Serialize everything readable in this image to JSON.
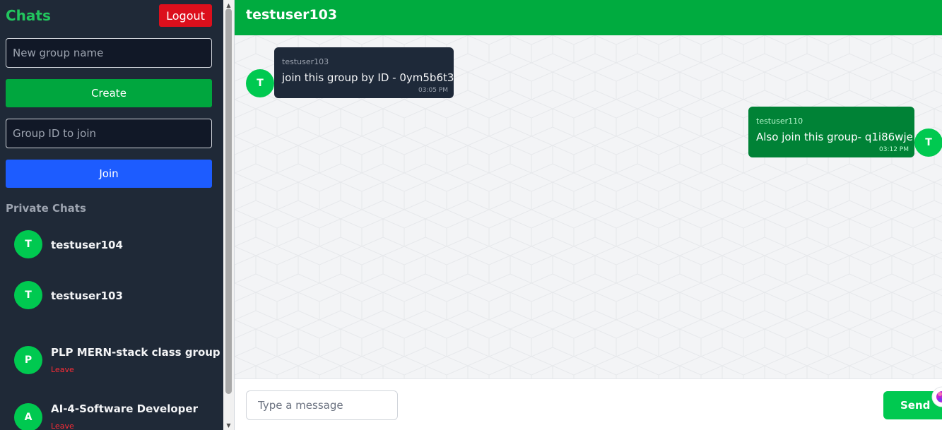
{
  "sidebar": {
    "title": "Chats",
    "logout_label": "Logout",
    "group_name_placeholder": "New group name",
    "create_label": "Create",
    "group_id_placeholder": "Group ID to join",
    "join_label": "Join",
    "section_title": "Private Chats",
    "chats": [
      {
        "initial": "T",
        "name": "testuser104",
        "leave": ""
      },
      {
        "initial": "T",
        "name": "testuser103",
        "leave": ""
      },
      {
        "initial": "P",
        "name": "PLP MERN-stack class group",
        "leave": "Leave"
      },
      {
        "initial": "A",
        "name": "AI-4-Software Developer",
        "leave": "Leave"
      }
    ]
  },
  "main": {
    "header_title": "testuser103",
    "messages": [
      {
        "initial": "T",
        "sender": "testuser103",
        "text": "join this group by ID - 0ym5b6t3",
        "time": "03:05 PM"
      },
      {
        "initial": "T",
        "sender": "testuser110",
        "text": "Also join this group- q1i86wje",
        "time": "03:12 PM"
      }
    ],
    "input_placeholder": "Type a message",
    "send_label": "Send"
  },
  "scrollbar": {
    "up_icon": "triangle-up-icon",
    "down_icon": "triangle-down-icon",
    "up_glyph": "▲",
    "down_glyph": "▼"
  },
  "colors": {
    "accent_green": "#00ab3f",
    "logout_red": "#dc0f1c",
    "join_blue": "#1d5cff",
    "sidebar_bg": "#1f2937",
    "leave_red": "#fb2c36"
  }
}
